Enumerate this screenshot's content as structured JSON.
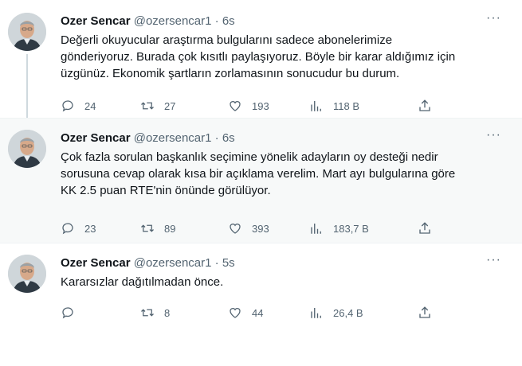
{
  "tweets": [
    {
      "name": "Ozer Sencar",
      "handle": "@ozersencar1",
      "separator": "·",
      "time": "6s",
      "more": "···",
      "text_lines": [
        "Değerli okuyucular araştırma bulgularını sadece abonelerimize",
        "gönderiyoruz. Burada çok kısıtlı paylaşıyoruz. Böyle bir karar aldığımız için",
        "üzgünüz. Ekonomik şartların zorlamasının sonucudur bu durum."
      ],
      "replies": "24",
      "retweets": "27",
      "likes": "193",
      "views": "118 B"
    },
    {
      "name": "Ozer Sencar",
      "handle": "@ozersencar1",
      "separator": "·",
      "time": "6s",
      "more": "···",
      "text_lines": [
        "Çok fazla sorulan başkanlık seçimine yönelik adayların oy desteği nedir",
        "sorusuna cevap olarak kısa bir açıklama verelim. Mart ayı bulgularına göre",
        "KK 2.5 puan RTE'nin önünde görülüyor."
      ],
      "replies": "23",
      "retweets": "89",
      "likes": "393",
      "views": "183,7 B"
    },
    {
      "name": "Ozer Sencar",
      "handle": "@ozersencar1",
      "separator": "·",
      "time": "5s",
      "more": "···",
      "text_lines": [
        "Kararsızlar dağıtılmadan önce."
      ],
      "replies": "",
      "retweets": "8",
      "likes": "44",
      "views": "26,4 B"
    }
  ],
  "icons": [
    "reply-icon",
    "retweet-icon",
    "like-icon",
    "views-icon",
    "share-icon",
    "more-icon"
  ],
  "colors": {
    "text": "#0f1419",
    "secondary": "#536471",
    "thread_line": "#cfd9de",
    "highlight_bg": "#f7f9f9"
  }
}
